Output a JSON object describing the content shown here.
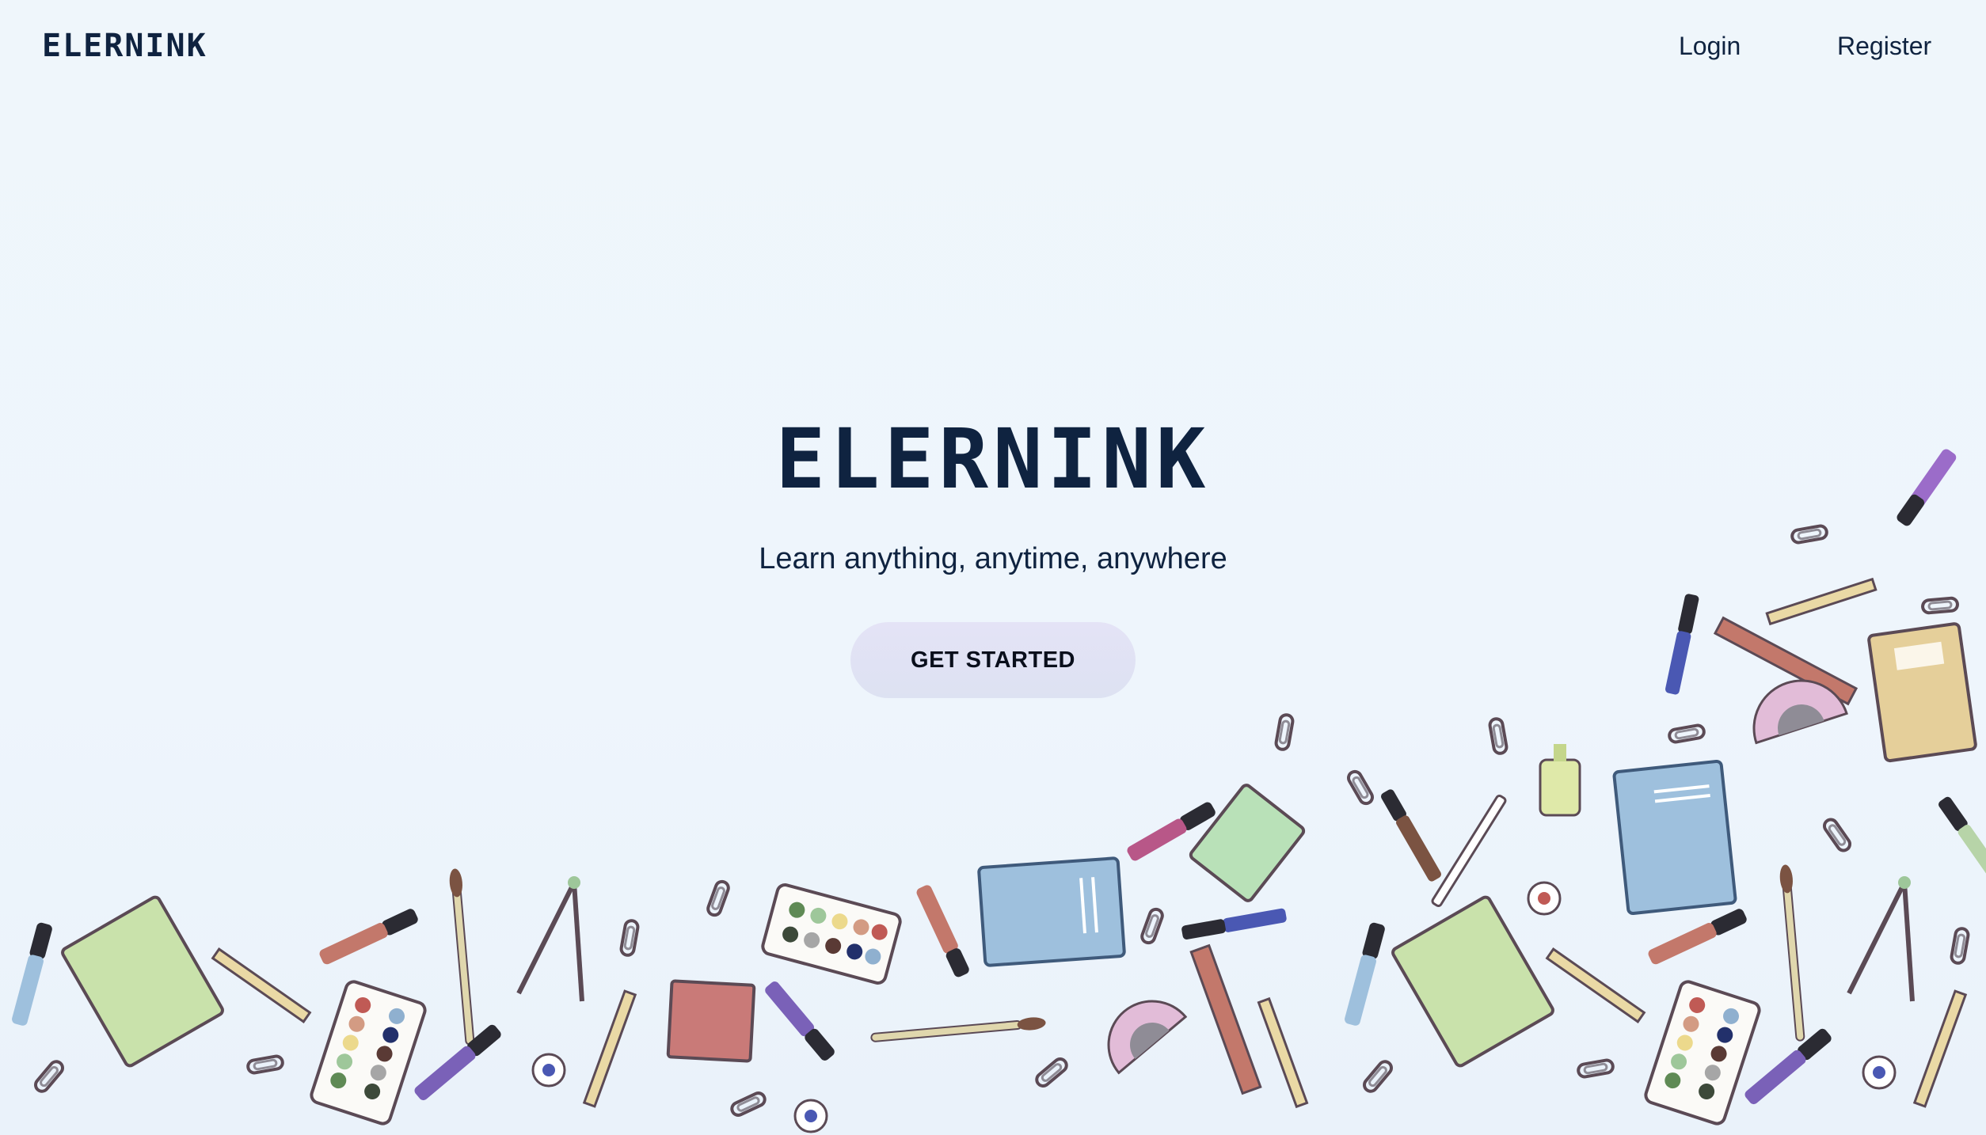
{
  "navbar": {
    "brand": "ELERNINK",
    "login": "Login",
    "register": "Register"
  },
  "hero": {
    "title": "ELERNINK",
    "subtitle": "Learn anything, anytime, anywhere",
    "cta": "GET STARTED"
  },
  "colors": {
    "primary_text": "#0f2340",
    "background": "#eff6fb",
    "cta_background": "#e2e2f5"
  },
  "illustration": {
    "icons": [
      "notebook-icon",
      "pencil-icon",
      "marker-icon",
      "paint-palette-icon",
      "paperclip-icon",
      "compass-icon",
      "protractor-icon",
      "ruler-icon",
      "paintbrush-icon",
      "glue-bottle-icon",
      "eraser-icon"
    ]
  }
}
